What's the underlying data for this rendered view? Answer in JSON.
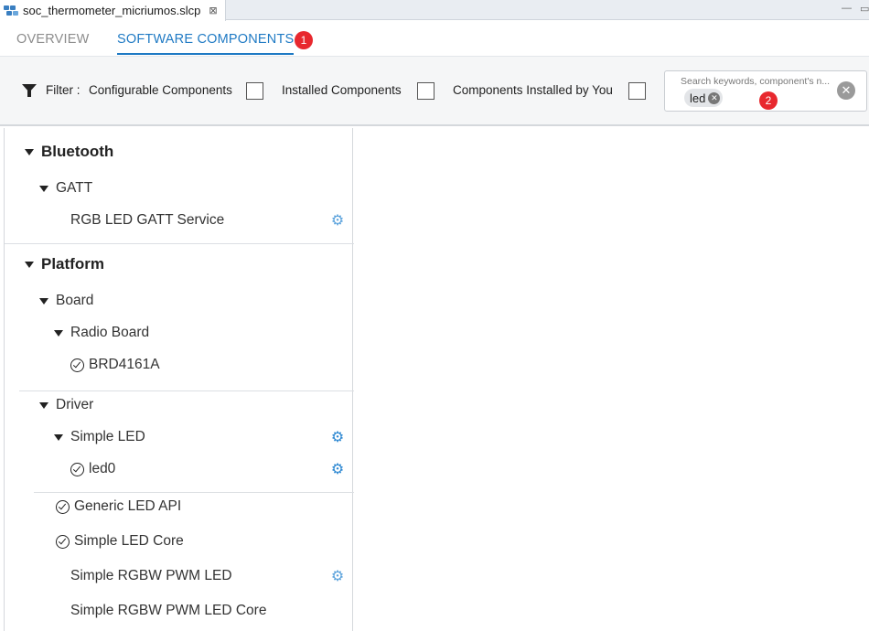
{
  "editor_tab": {
    "filename": "soc_thermometer_micriumos.slcp",
    "close_glyph": "⊠"
  },
  "tabs": [
    {
      "label": "OVERVIEW",
      "active": false
    },
    {
      "label": "SOFTWARE COMPONENTS",
      "active": true,
      "badge": "1"
    }
  ],
  "filter": {
    "label": "Filter :",
    "options": [
      {
        "label": "Configurable Components",
        "checked": false
      },
      {
        "label": "Installed Components",
        "checked": false
      },
      {
        "label": "Components Installed by You",
        "checked": false
      }
    ]
  },
  "search": {
    "placeholder": "Search keywords, component's n...",
    "chip": "led",
    "badge": "2"
  },
  "tree": {
    "bluetooth": {
      "label": "Bluetooth",
      "gatt": {
        "label": "GATT",
        "items": [
          {
            "label": "RGB LED GATT Service",
            "configurable": true
          }
        ]
      }
    },
    "platform": {
      "label": "Platform",
      "board": {
        "label": "Board",
        "radio_board": {
          "label": "Radio Board",
          "items": [
            {
              "label": "BRD4161A",
              "installed": true
            }
          ]
        }
      },
      "driver": {
        "label": "Driver",
        "simple_led": {
          "label": "Simple LED",
          "items": [
            {
              "label": "led0",
              "installed": true
            }
          ]
        },
        "items": [
          {
            "label": "Generic LED API",
            "installed": true
          },
          {
            "label": "Simple LED Core",
            "installed": true
          },
          {
            "label": "Simple RGBW PWM LED",
            "installed": false
          },
          {
            "label": "Simple RGBW PWM LED Core",
            "installed": false
          }
        ]
      }
    }
  },
  "colors": {
    "accent": "#1f7ac4",
    "badge": "#e8282e",
    "gear": "#2a86d1"
  }
}
